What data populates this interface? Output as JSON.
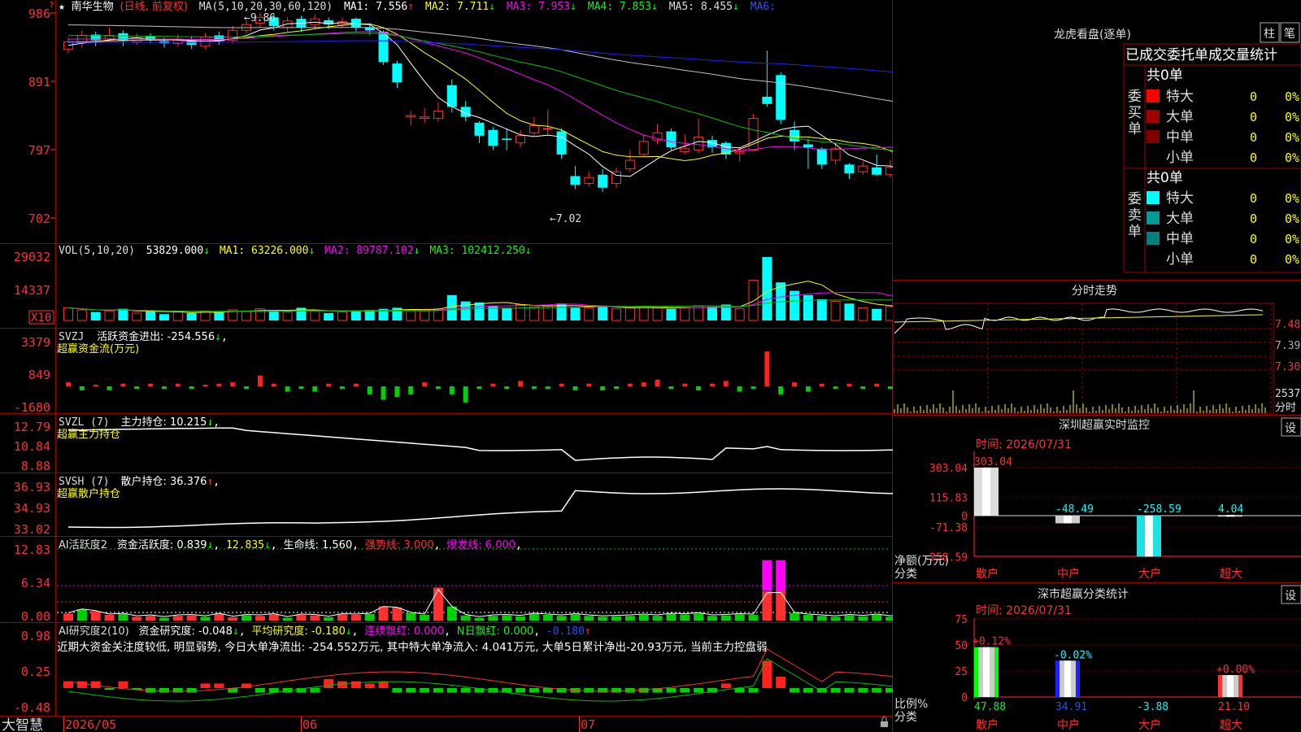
{
  "colors": {
    "up": "#ff3030",
    "down": "#00ffff",
    "vol_up": "#ff3030",
    "flow_up": "#ff2020",
    "flow_down": "#00d000",
    "ma1": "#ffffff",
    "ma2": "#ffff00",
    "ma3": "#ff00ff",
    "ma4": "#00c000",
    "ma5": "#c0c0c0",
    "ma6": "#2020ff"
  },
  "header": {
    "star": "★",
    "stock_name": "南华生物",
    "period_label": "(日线, 前复权)",
    "ma_label": "MA(5,10,20,30,60,120)",
    "ma1": "MA1: 7.556",
    "ma2": "MA2: 7.711",
    "ma3": "MA3: 7.953",
    "ma4": "MA4: 7.853",
    "ma5": "MA5: 8.455",
    "ma6": "MA6: ",
    "arrow_up": "↑",
    "arrow_down": "↓"
  },
  "price_panel": {
    "y_ticks": [
      "986",
      "891",
      "797",
      "702"
    ],
    "hi_label": "9.86",
    "lo_label": "7.02"
  },
  "vol_panel": {
    "title": "VOL(5,10,20)",
    "v": "53829.000",
    "ma1": "MA1: 63226.000",
    "ma2": "MA2: 89787.102",
    "ma3": "MA3: 102412.250",
    "y_ticks": [
      "29032",
      "14337"
    ],
    "unit": "X10"
  },
  "svzj_panel": {
    "title": "SVZJ",
    "label": "活跃资金进出: -254.556",
    "sub": "超赢资金流(万元)",
    "y_ticks": [
      "3379",
      "849",
      "-1680"
    ]
  },
  "svzl_panel": {
    "title": "SVZL (7)",
    "label": "主力持仓: 10.215",
    "sub": "超赢主力持仓",
    "y_ticks": [
      "12.79",
      "10.84",
      "8.88"
    ]
  },
  "svsh_panel": {
    "title": "SVSH (7)",
    "label": "散户持仓: 36.376",
    "sub": "超赢散户持仓",
    "y_ticks": [
      "36.93",
      "34.93",
      "33.02"
    ]
  },
  "ai_active_panel": {
    "title": "AI活跃度2",
    "label": "资金活跃度: 0.839",
    "v2": "12.835",
    "life": "生命线: 1.560",
    "strong": "强势线: 3.000",
    "burst": "爆发线: 6.000",
    "y_ticks": [
      "12.83",
      "6.34",
      "0.00"
    ]
  },
  "ai_research_panel": {
    "title": "AI研究度2(10)",
    "label": "资金研究度: -0.048",
    "avg": "平均研究度: -0.180",
    "cont": "连续飘红: 0.000",
    "nday": "N日飘红: 0.000",
    "last": "-0.180",
    "note": "近期大资金关注度较低, 明显弱势, 今日大单净流出: -254.552万元, 其中特大单净流入: 4.041万元, 大单5日累计净出-20.93万元, 当前主力控盘弱",
    "y_ticks": [
      "0.98",
      "0.25",
      "-0.48"
    ]
  },
  "bottom_bar": {
    "brand": "大智慧",
    "dates": [
      "2026/05",
      "06",
      "07"
    ]
  },
  "right_top": {
    "title": "龙虎看盘(逐单)",
    "btn_bar": "柱",
    "btn_pen": "笔",
    "tab_text": "已成交委托单成交量统计",
    "buy_label": "委买单",
    "sell_label": "委卖单",
    "buy_total": "共0单",
    "sell_total": "共0单",
    "buy_rows": [
      {
        "name": "特大",
        "count": "0",
        "pct": "0%",
        "color": "#ff0000"
      },
      {
        "name": "大单",
        "count": "0",
        "pct": "0%",
        "color": "#a00000"
      },
      {
        "name": "中单",
        "count": "0",
        "pct": "0%",
        "color": "#800000"
      },
      {
        "name": "小单",
        "count": "0",
        "pct": "0%",
        "color": ""
      }
    ],
    "sell_rows": [
      {
        "name": "特大",
        "count": "0",
        "pct": "0%",
        "color": "#00ffff"
      },
      {
        "name": "大单",
        "count": "0",
        "pct": "0%",
        "color": "#009999"
      },
      {
        "name": "中单",
        "count": "0",
        "pct": "0%",
        "color": "#008080"
      },
      {
        "name": "小单",
        "count": "0",
        "pct": "0%",
        "color": ""
      }
    ]
  },
  "intraday": {
    "title": "分时走势",
    "y_ticks": [
      "7.48",
      "7.39",
      "7.30"
    ],
    "vol_tick": "2537",
    "vol_label": "分时"
  },
  "monitor": {
    "title": "深圳超赢实时监控",
    "settings_btn": "设",
    "time": "时间: 2026/07/31",
    "y_ticks": [
      "303.04",
      "115.83",
      "0",
      "-71.38",
      "-258.59"
    ],
    "axis_label": "净额(万元)",
    "cat_label": "分类",
    "categories": [
      "散户",
      "中户",
      "大户",
      "超大"
    ],
    "values": [
      303.04,
      -48.49,
      -258.59,
      4.04
    ],
    "value_labels": [
      "303.04",
      "-48.49",
      "-258.59",
      "4.04"
    ]
  },
  "classify": {
    "title": "深市超赢分类统计",
    "settings_btn": "设",
    "time": "时间: 2026/07/31",
    "y_ticks": [
      "75",
      "50",
      "25",
      "0"
    ],
    "axis_label": "比例%",
    "cat_label": "分类",
    "categories": [
      "散户",
      "中户",
      "大户",
      "超大"
    ],
    "change_labels": [
      "+0.12%",
      "-0.02%",
      "",
      "+0.00%"
    ],
    "values": [
      47.88,
      34.91,
      -3.88,
      21.1
    ],
    "value_labels": [
      "47.88",
      "34.91",
      "-3.88",
      "21.10"
    ]
  }
}
